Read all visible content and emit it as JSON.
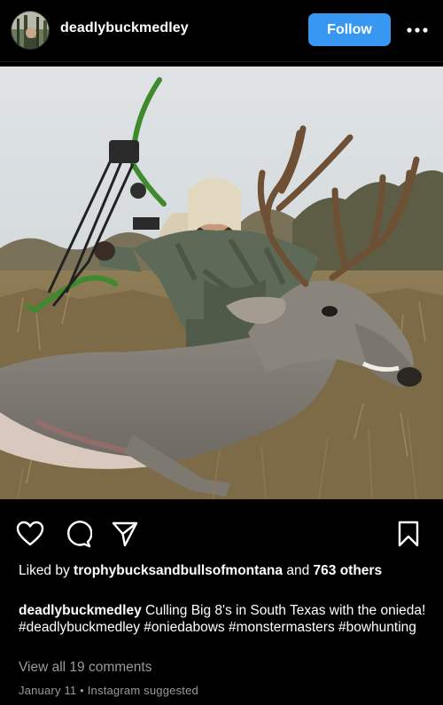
{
  "post": {
    "username": "deadlybuckmedley",
    "follow_label": "Follow"
  },
  "likes": {
    "prefix": "Liked by",
    "liker": "trophybucksandbullsofmontana",
    "middle": "and",
    "count": "763",
    "suffix": "others"
  },
  "caption": {
    "user": "deadlybuckmedley",
    "text": "Culling Big 8's in South Texas with the onieda! #deadlybuckmedley #oniedabows #monstermasters #bowhunting"
  },
  "comments": {
    "view_all": "View all 19 comments"
  },
  "meta": {
    "date": "January 11",
    "separator": "•",
    "source": "Instagram suggested"
  },
  "colors": {
    "accent": "#3897f0",
    "background": "#000000",
    "secondary_text": "#9a9a9a"
  },
  "icons": [
    "avatar",
    "more-icon",
    "heart-icon",
    "comment-icon",
    "share-icon",
    "bookmark-icon"
  ]
}
